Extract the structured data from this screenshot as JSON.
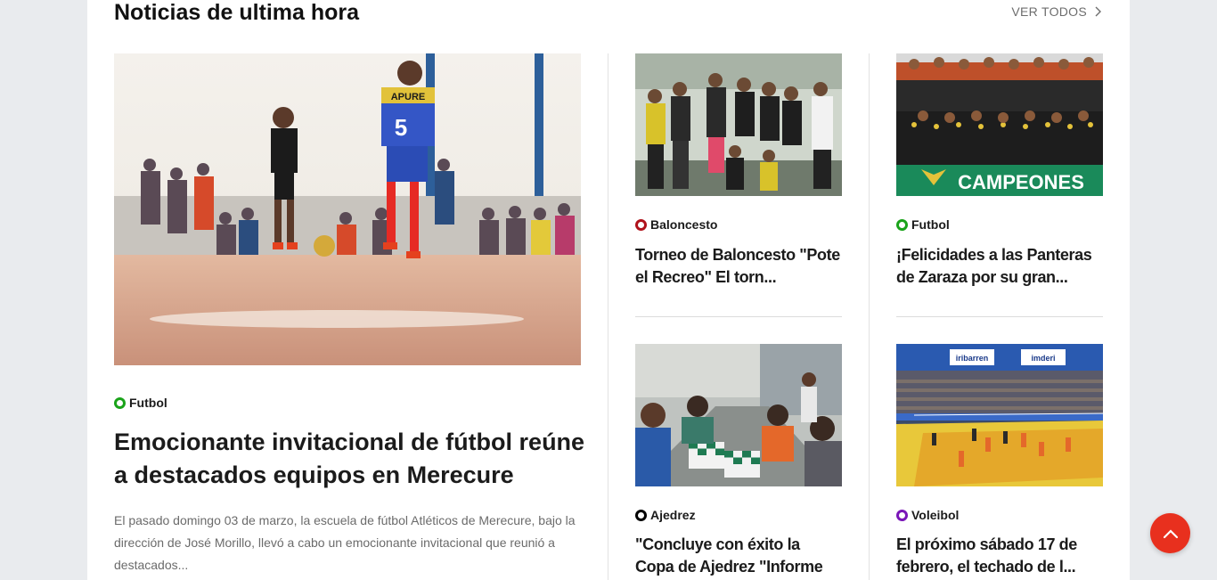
{
  "section": {
    "title": "Noticias de ultima hora",
    "view_all": "VER TODOS"
  },
  "featured": {
    "category": "Futbol",
    "category_color": "#1aa31a",
    "title": "Emocionante invitacional de fútbol reúne a destacados equipos en Merecure",
    "excerpt": "El pasado domingo 03 de marzo, la escuela de fútbol Atléticos de Merecure, bajo la dirección de José Morillo, llevó a cabo un emocionante invitacional que reunió a destacados...",
    "image_alt": "children playing futsal",
    "jersey_text": "APURE",
    "jersey_number": "5"
  },
  "cards": [
    {
      "category": "Baloncesto",
      "category_color": "#b0121b",
      "title": "Torneo de Baloncesto \"Pote el Recreo\" El torn..."
    },
    {
      "category": "Futbol",
      "category_color": "#1aa31a",
      "title": "¡Felicidades a las Panteras de Zaraza por su gran...",
      "banner_text": "CAMPEONES"
    },
    {
      "category": "Ajedrez",
      "category_color": "#000000",
      "title": "\"Concluye con éxito la Copa de Ajedrez \"Informe D..."
    },
    {
      "category": "Voleibol",
      "category_color": "#7a16b8",
      "title": "El próximo sábado 17 de febrero, el techado de l...",
      "banner_text_1": "iribarren",
      "banner_text_2": "imderi"
    }
  ]
}
